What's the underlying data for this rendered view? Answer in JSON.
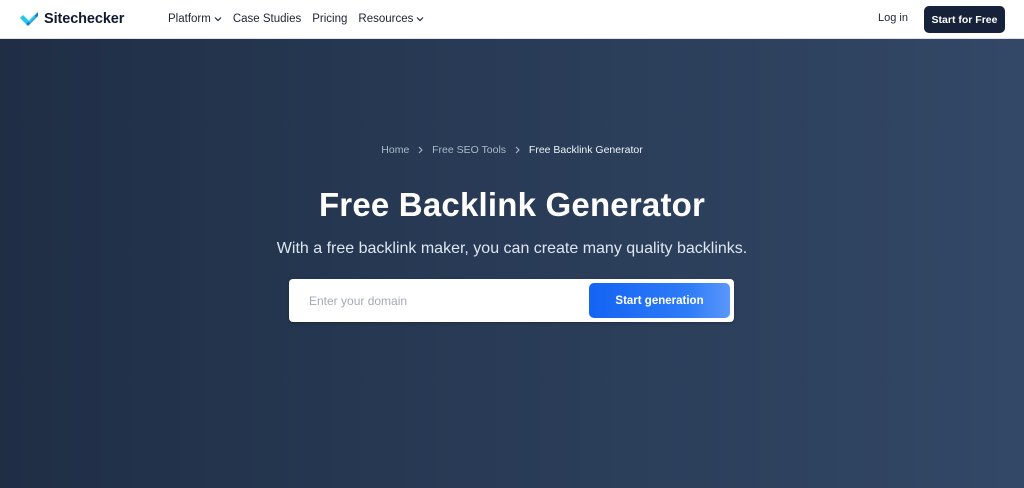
{
  "brand": {
    "name": "Sitechecker",
    "accent": "#1ec8e8",
    "accent_dark": "#0b7fd6"
  },
  "nav": {
    "items": [
      {
        "label": "Platform",
        "has_dropdown": true
      },
      {
        "label": "Case Studies",
        "has_dropdown": false
      },
      {
        "label": "Pricing",
        "has_dropdown": false
      },
      {
        "label": "Resources",
        "has_dropdown": true
      }
    ],
    "login_label": "Log in",
    "cta_label": "Start for Free"
  },
  "breadcrumb": {
    "items": [
      "Home",
      "Free SEO Tools",
      "Free Backlink Generator"
    ],
    "separator_icon": "chevron-right-icon"
  },
  "hero": {
    "title": "Free Backlink Generator",
    "subtitle": "With a free backlink maker, you can create many quality backlinks."
  },
  "search": {
    "value": "",
    "placeholder": "Enter your domain",
    "button_label": "Start generation"
  },
  "colors": {
    "header_bg": "#ffffff",
    "hero_bg_left": "#1f2e45",
    "hero_bg_right": "#324866",
    "cta_bg": "#16213a",
    "button_blue": "#1463f3"
  }
}
